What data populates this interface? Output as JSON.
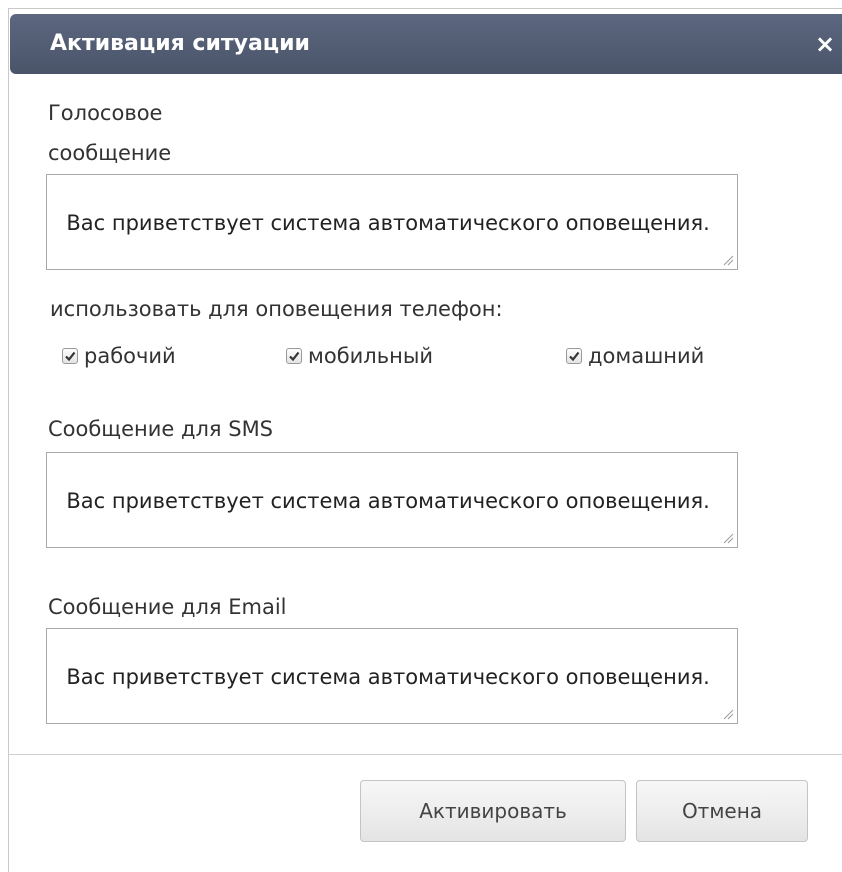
{
  "dialog": {
    "title": "Активация ситуации",
    "close_symbol": "×",
    "close_icon": "close-icon"
  },
  "voice": {
    "label_line1": "Голосовое",
    "label_line2": "сообщение",
    "value": "Вас приветствует система автоматического оповещения."
  },
  "phones": {
    "label": "использовать для оповещения телефон:",
    "options": [
      {
        "label": "рабочий",
        "checked": true
      },
      {
        "label": "мобильный",
        "checked": true
      },
      {
        "label": "домашний",
        "checked": true
      }
    ]
  },
  "sms": {
    "label": "Сообщение для SMS",
    "value": "Вас приветствует система автоматического оповещения."
  },
  "email": {
    "label": "Сообщение для Email",
    "value": "Вас приветствует система автоматического оповещения."
  },
  "buttons": {
    "activate": "Активировать",
    "cancel": "Отмена"
  },
  "colors": {
    "titlebar": "#545e74",
    "title_text": "#ffffff",
    "border": "#a9a9a9"
  }
}
